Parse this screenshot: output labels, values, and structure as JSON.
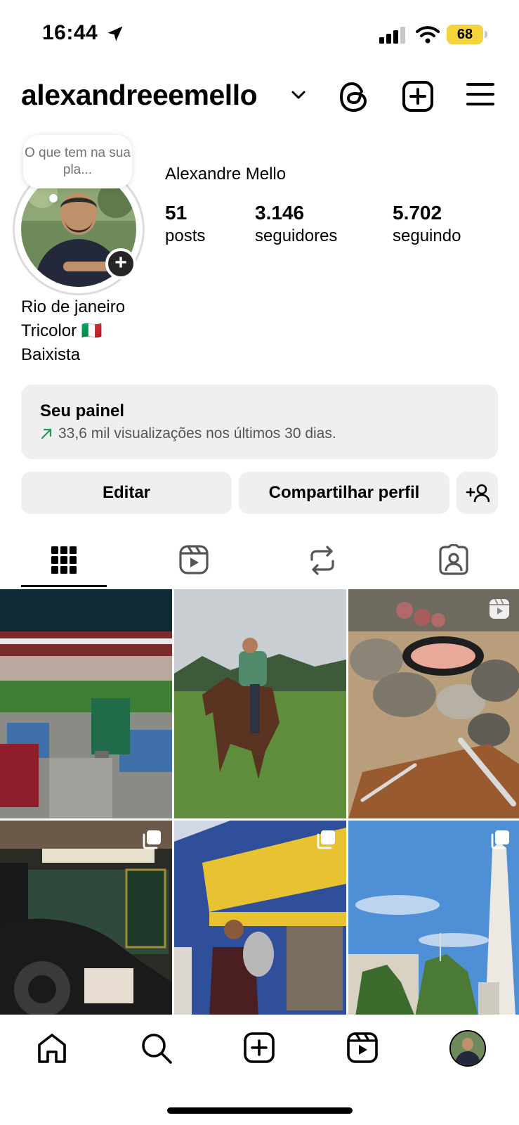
{
  "status_bar": {
    "time": "16:44",
    "battery": "68"
  },
  "header": {
    "username": "alexandreeemello"
  },
  "profile": {
    "note": "O que tem na sua pla...",
    "display_name": "Alexandre Mello",
    "stats": [
      {
        "value": "51",
        "label": "posts"
      },
      {
        "value": "3.146",
        "label": "seguidores"
      },
      {
        "value": "5.702",
        "label": "seguindo"
      }
    ],
    "bio": [
      "Rio de janeiro",
      "Tricolor 🇮🇹",
      "Baixista"
    ]
  },
  "dashboard": {
    "title": "Seu painel",
    "subtitle": "33,6 mil visualizações nos últimos 30 dias."
  },
  "buttons": {
    "edit": "Editar",
    "share": "Compartilhar perfil"
  },
  "tabs": [
    "grid-icon",
    "reels-icon",
    "reposts-icon",
    "tagged-icon"
  ],
  "grid": [
    {
      "subject": "stadium",
      "badge": ""
    },
    {
      "subject": "horse",
      "badge": ""
    },
    {
      "subject": "bbq",
      "badge": "reel-icon"
    },
    {
      "subject": "bar",
      "badge": "carousel-icon"
    },
    {
      "subject": "trophy",
      "badge": "carousel-icon"
    },
    {
      "subject": "obelisk",
      "badge": "carousel-icon"
    }
  ],
  "colors": {
    "surface": "#efeff1",
    "text": "#000000",
    "muted": "#737373",
    "trend": "#1f9d55"
  }
}
